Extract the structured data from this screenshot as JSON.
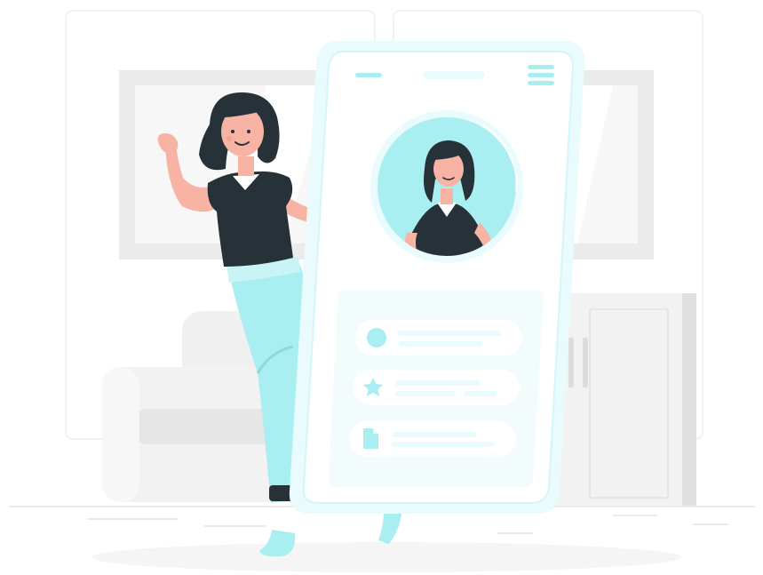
{
  "scene": {
    "type": "flat-illustration",
    "subject": "woman-beside-giant-smartphone-profile-screen"
  },
  "colors": {
    "accent": "#a9eef1",
    "accent_light": "#e9fbfc",
    "hair_and_shirt": "#263238",
    "skin": "#f7b3a3",
    "background_gray": "#ebebeb",
    "light_gray": "#f5f5f5",
    "white": "#ffffff"
  },
  "phone": {
    "header_icons": [
      "back-dash-icon",
      "title-pill-icon",
      "hamburger-menu-icon"
    ],
    "avatar": "profile-avatar-icon",
    "list_items": [
      {
        "icon": "circle-icon"
      },
      {
        "icon": "star-icon"
      },
      {
        "icon": "document-icon"
      }
    ]
  },
  "background": {
    "items": [
      "left-wall-panel",
      "right-wall-panel",
      "wall-picture-frame",
      "sofa",
      "cabinet",
      "floor-line",
      "floor-shadow"
    ]
  }
}
